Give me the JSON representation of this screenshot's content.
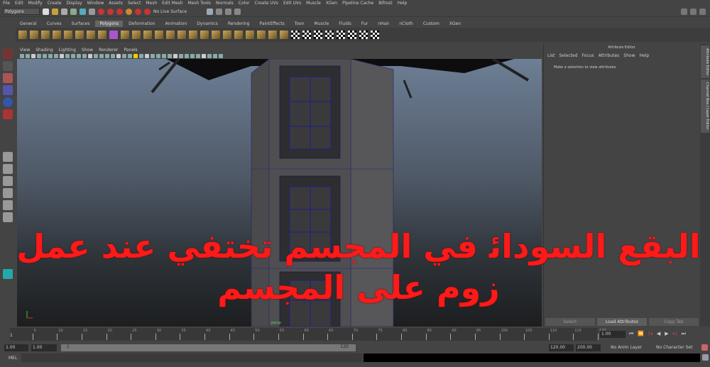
{
  "menubar": [
    "File",
    "Edit",
    "Modify",
    "Create",
    "Display",
    "Window",
    "Assets",
    "Select",
    "Mesh",
    "Edit Mesh",
    "Mesh Tools",
    "Normals",
    "Color",
    "Create UVs",
    "Edit UVs",
    "Muscle",
    "XGen",
    "Pipeline Cache",
    "Bifrost",
    "Help"
  ],
  "status": {
    "mode": "Polygons",
    "live_surface": "No Live Surface"
  },
  "shelf_tabs": [
    "General",
    "Curves",
    "Surfaces",
    "Polygons",
    "Deformation",
    "Animation",
    "Dynamics",
    "Rendering",
    "PaintEffects",
    "Toon",
    "Muscle",
    "Fluids",
    "Fur",
    "nHair",
    "nCloth",
    "Custom",
    "XGen"
  ],
  "active_shelf": "Polygons",
  "panel_menu": [
    "View",
    "Shading",
    "Lighting",
    "Show",
    "Renderer",
    "Panels"
  ],
  "viewport": {
    "camera_label": "persp"
  },
  "attribute_editor": {
    "title": "Attribute Editor",
    "menu": [
      "List",
      "Selected",
      "Focus",
      "Attributes",
      "Show",
      "Help"
    ],
    "message": "Make a selection to view attributes",
    "buttons": [
      "Select",
      "Load Attributes",
      "Copy Tab"
    ]
  },
  "side_tabs": [
    "Attribute Editor",
    "Channel Box / Layer Editor"
  ],
  "timeline": {
    "ticks": [
      "5",
      "10",
      "15",
      "20",
      "25",
      "30",
      "35",
      "40",
      "45",
      "50",
      "55",
      "60",
      "65",
      "70",
      "75",
      "80",
      "85",
      "90",
      "95",
      "100",
      "105",
      "110",
      "115",
      "120"
    ],
    "current_frame": "1",
    "current_field": "1.00"
  },
  "range": {
    "start": "1.00",
    "inner_start": "1.00",
    "slider_start": "1",
    "slider_end": "120",
    "end": "120.00",
    "outer_end": "200.00",
    "anim_layer": "No Anim Layer",
    "char_set": "No Character Set"
  },
  "cmd": {
    "label": "MEL"
  },
  "overlay_text": "البقع السوداﺋ في المجسم تختفي عند عمل زوم على المجسم"
}
